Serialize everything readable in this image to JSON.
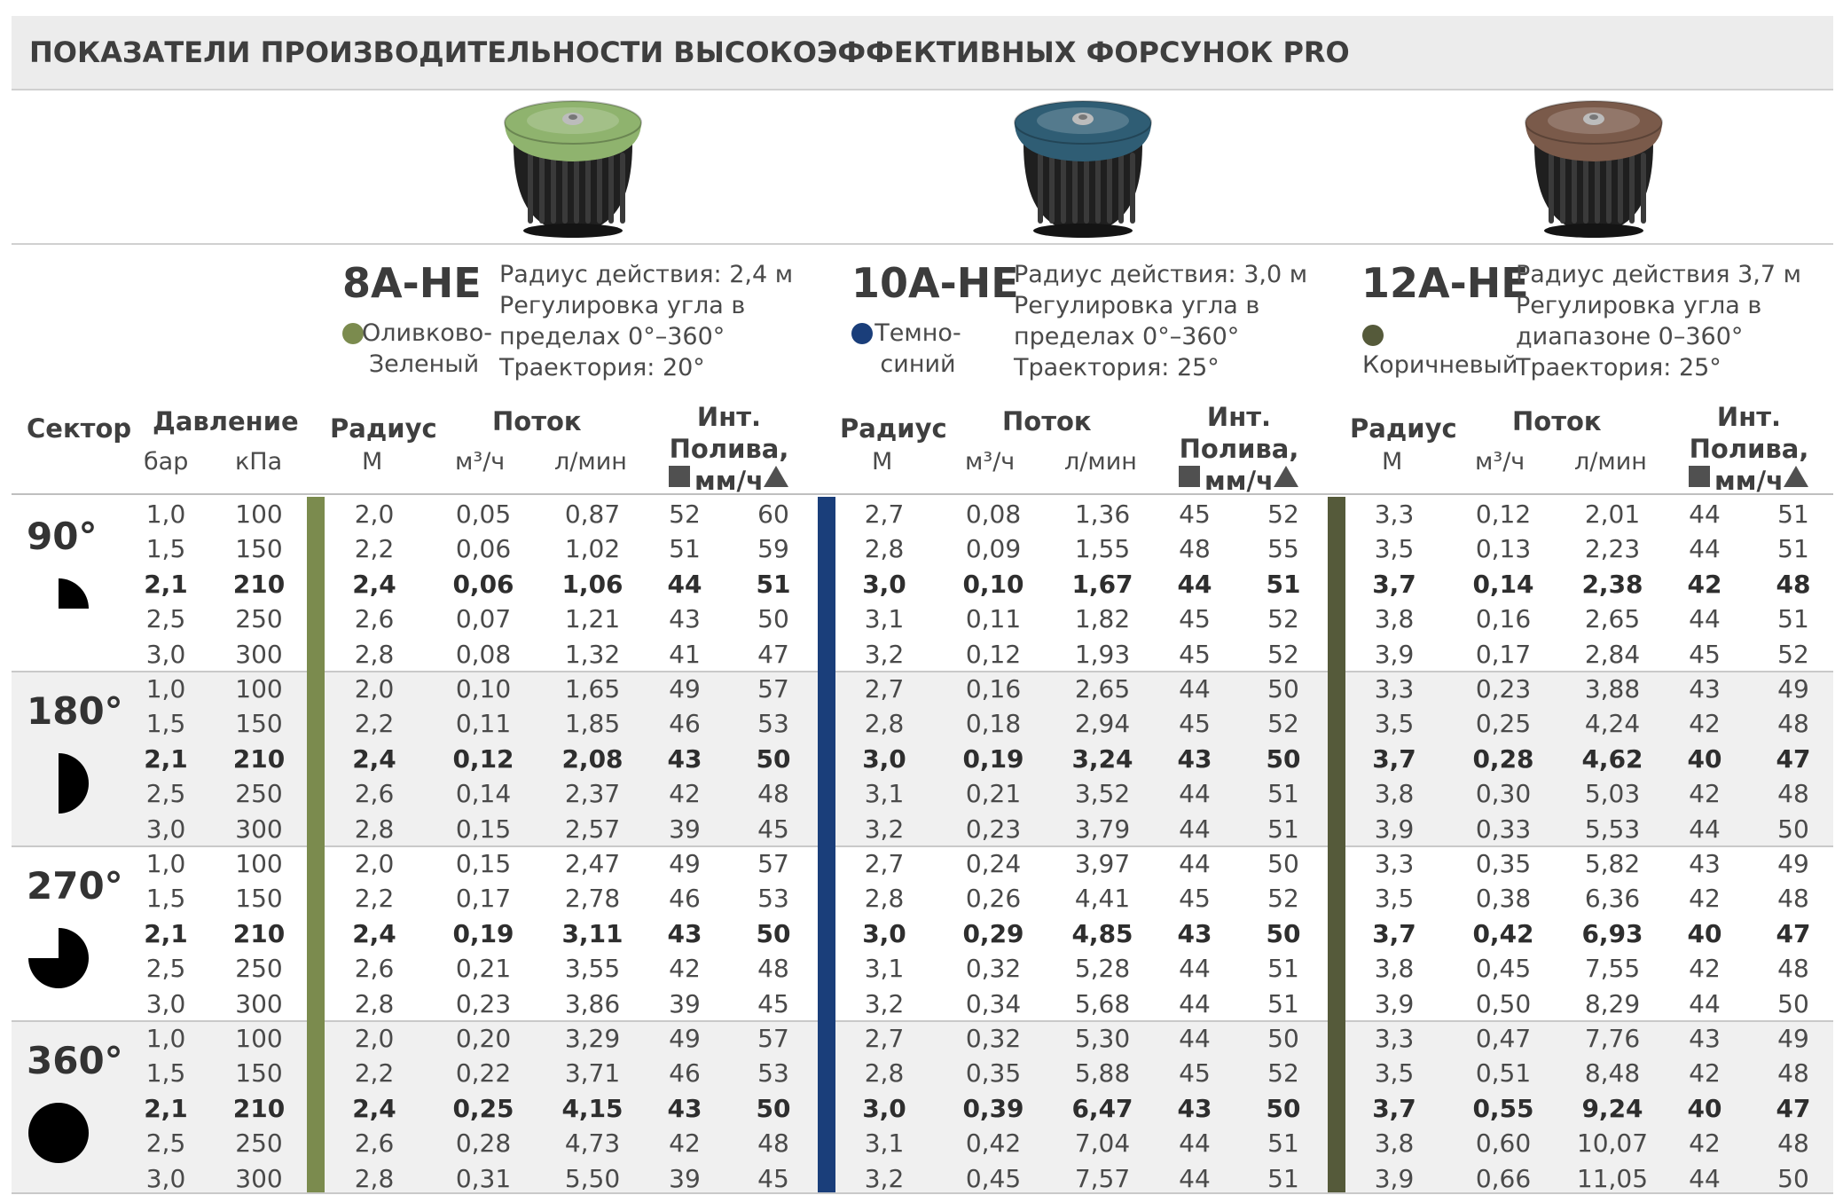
{
  "title": "ПОКАЗАТЕЛИ ПРОИЗВОДИТЕЛЬНОСТИ ВЫСОКОЭФФЕКТИВНЫХ ФОРСУНОК PRO",
  "nozzles": [
    {
      "code": "8A-HE",
      "color_name": "Оливково-\nЗеленый",
      "color": "#7b8b4e",
      "cap_color": "#8fb36e",
      "specs": [
        "Радиус действия: 2,4 м",
        "Регулировка угла в",
        "пределах 0°–360°",
        "Траектория: 20°"
      ]
    },
    {
      "code": "10A-HE",
      "color_name": "Темно-\nсиний",
      "color": "#1a3e7a",
      "cap_color": "#2f5d74",
      "specs": [
        "Радиус действия: 3,0 м",
        "Регулировка угла в",
        "пределах 0°–360°",
        "Траектория: 25°"
      ]
    },
    {
      "code": "12A-HE",
      "color_name": "Коричневый",
      "color": "#555a3a",
      "cap_color": "#7a5a4a",
      "specs": [
        "Радиус действия 3,7 м",
        "Регулировка угла в",
        "диапазоне 0–360°",
        "Траектория: 25°"
      ]
    }
  ],
  "headers": {
    "sector": "Сектор",
    "pressure": "Давление",
    "bar": "бар",
    "kpa": "кПа",
    "radius": "Радиус",
    "m": "М",
    "flow": "Поток",
    "m3h": "м³/ч",
    "lmin": "л/мин",
    "precip": "Инт. Полива,\nмм/ч",
    "precip_icons": [
      "square-spacing-icon",
      "triangle-spacing-icon"
    ]
  },
  "sectors": [
    {
      "label": "90°",
      "icon": "quarter-circle-icon",
      "rows": [
        [
          "1,0",
          "100",
          "2,0",
          "0,05",
          "0,87",
          "52",
          "60",
          "2,7",
          "0,08",
          "1,36",
          "45",
          "52",
          "3,3",
          "0,12",
          "2,01",
          "44",
          "51"
        ],
        [
          "1,5",
          "150",
          "2,2",
          "0,06",
          "1,02",
          "51",
          "59",
          "2,8",
          "0,09",
          "1,55",
          "48",
          "55",
          "3,5",
          "0,13",
          "2,23",
          "44",
          "51"
        ],
        [
          "2,1",
          "210",
          "2,4",
          "0,06",
          "1,06",
          "44",
          "51",
          "3,0",
          "0,10",
          "1,67",
          "44",
          "51",
          "3,7",
          "0,14",
          "2,38",
          "42",
          "48"
        ],
        [
          "2,5",
          "250",
          "2,6",
          "0,07",
          "1,21",
          "43",
          "50",
          "3,1",
          "0,11",
          "1,82",
          "45",
          "52",
          "3,8",
          "0,16",
          "2,65",
          "44",
          "51"
        ],
        [
          "3,0",
          "300",
          "2,8",
          "0,08",
          "1,32",
          "41",
          "47",
          "3,2",
          "0,12",
          "1,93",
          "45",
          "52",
          "3,9",
          "0,17",
          "2,84",
          "45",
          "52"
        ]
      ]
    },
    {
      "label": "180°",
      "icon": "half-circle-icon",
      "rows": [
        [
          "1,0",
          "100",
          "2,0",
          "0,10",
          "1,65",
          "49",
          "57",
          "2,7",
          "0,16",
          "2,65",
          "44",
          "50",
          "3,3",
          "0,23",
          "3,88",
          "43",
          "49"
        ],
        [
          "1,5",
          "150",
          "2,2",
          "0,11",
          "1,85",
          "46",
          "53",
          "2,8",
          "0,18",
          "2,94",
          "45",
          "52",
          "3,5",
          "0,25",
          "4,24",
          "42",
          "48"
        ],
        [
          "2,1",
          "210",
          "2,4",
          "0,12",
          "2,08",
          "43",
          "50",
          "3,0",
          "0,19",
          "3,24",
          "43",
          "50",
          "3,7",
          "0,28",
          "4,62",
          "40",
          "47"
        ],
        [
          "2,5",
          "250",
          "2,6",
          "0,14",
          "2,37",
          "42",
          "48",
          "3,1",
          "0,21",
          "3,52",
          "44",
          "51",
          "3,8",
          "0,30",
          "5,03",
          "42",
          "48"
        ],
        [
          "3,0",
          "300",
          "2,8",
          "0,15",
          "2,57",
          "39",
          "45",
          "3,2",
          "0,23",
          "3,79",
          "44",
          "51",
          "3,9",
          "0,33",
          "5,53",
          "44",
          "50"
        ]
      ]
    },
    {
      "label": "270°",
      "icon": "three-quarter-circle-icon",
      "rows": [
        [
          "1,0",
          "100",
          "2,0",
          "0,15",
          "2,47",
          "49",
          "57",
          "2,7",
          "0,24",
          "3,97",
          "44",
          "50",
          "3,3",
          "0,35",
          "5,82",
          "43",
          "49"
        ],
        [
          "1,5",
          "150",
          "2,2",
          "0,17",
          "2,78",
          "46",
          "53",
          "2,8",
          "0,26",
          "4,41",
          "45",
          "52",
          "3,5",
          "0,38",
          "6,36",
          "42",
          "48"
        ],
        [
          "2,1",
          "210",
          "2,4",
          "0,19",
          "3,11",
          "43",
          "50",
          "3,0",
          "0,29",
          "4,85",
          "43",
          "50",
          "3,7",
          "0,42",
          "6,93",
          "40",
          "47"
        ],
        [
          "2,5",
          "250",
          "2,6",
          "0,21",
          "3,55",
          "42",
          "48",
          "3,1",
          "0,32",
          "5,28",
          "44",
          "51",
          "3,8",
          "0,45",
          "7,55",
          "42",
          "48"
        ],
        [
          "3,0",
          "300",
          "2,8",
          "0,23",
          "3,86",
          "39",
          "45",
          "3,2",
          "0,34",
          "5,68",
          "44",
          "51",
          "3,9",
          "0,50",
          "8,29",
          "44",
          "50"
        ]
      ]
    },
    {
      "label": "360°",
      "icon": "full-circle-icon",
      "rows": [
        [
          "1,0",
          "100",
          "2,0",
          "0,20",
          "3,29",
          "49",
          "57",
          "2,7",
          "0,32",
          "5,30",
          "44",
          "50",
          "3,3",
          "0,47",
          "7,76",
          "43",
          "49"
        ],
        [
          "1,5",
          "150",
          "2,2",
          "0,22",
          "3,71",
          "46",
          "53",
          "2,8",
          "0,35",
          "5,88",
          "45",
          "52",
          "3,5",
          "0,51",
          "8,48",
          "42",
          "48"
        ],
        [
          "2,1",
          "210",
          "2,4",
          "0,25",
          "4,15",
          "43",
          "50",
          "3,0",
          "0,39",
          "6,47",
          "43",
          "50",
          "3,7",
          "0,55",
          "9,24",
          "40",
          "47"
        ],
        [
          "2,5",
          "250",
          "2,6",
          "0,28",
          "4,73",
          "42",
          "48",
          "3,1",
          "0,42",
          "7,04",
          "44",
          "51",
          "3,8",
          "0,60",
          "10,07",
          "42",
          "48"
        ],
        [
          "3,0",
          "300",
          "2,8",
          "0,31",
          "5,50",
          "39",
          "45",
          "3,2",
          "0,45",
          "7,57",
          "44",
          "51",
          "3,9",
          "0,66",
          "11,05",
          "44",
          "50"
        ]
      ]
    }
  ]
}
